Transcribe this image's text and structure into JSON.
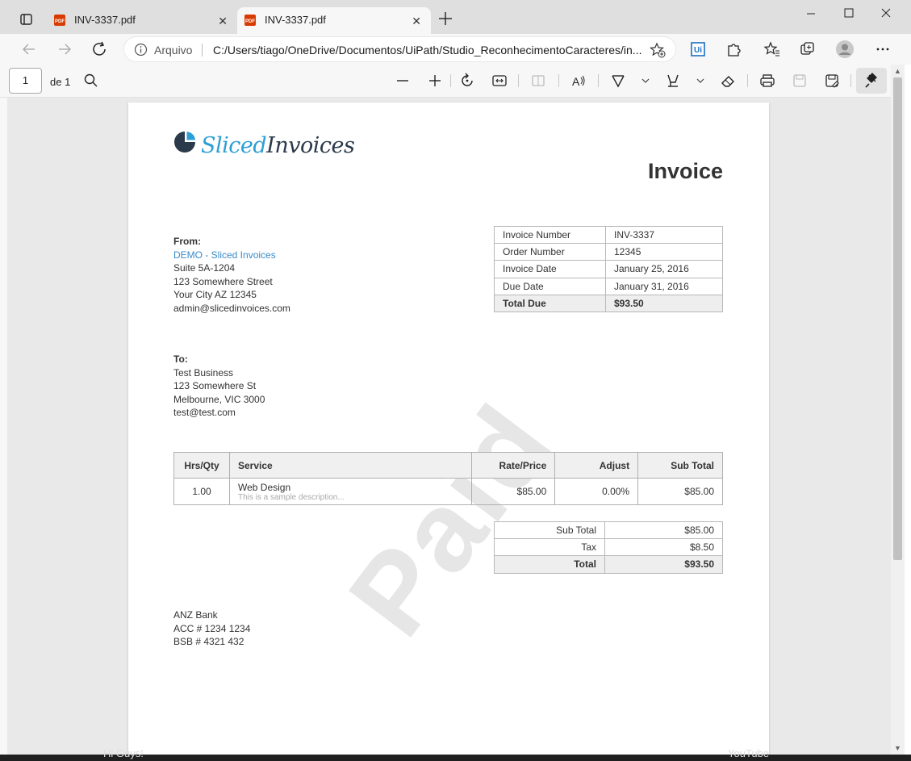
{
  "tabs": [
    {
      "label": "INV-3337.pdf",
      "active": false
    },
    {
      "label": "INV-3337.pdf",
      "active": true
    }
  ],
  "address_bar": {
    "scheme_label": "Arquivo",
    "url": "C:/Users/tiago/OneDrive/Documentos/UiPath/Studio_ReconhecimentoCaracteres/in..."
  },
  "pdf_toolbar": {
    "page_number": "1",
    "page_count": "de 1"
  },
  "invoice": {
    "logo": {
      "part1": "Sliced",
      "part2": "Invoices"
    },
    "title": "Invoice",
    "from": {
      "heading": "From:",
      "company": "DEMO - Sliced Invoices",
      "lines": [
        "Suite 5A-1204",
        "123 Somewhere Street",
        "Your City AZ 12345",
        "admin@slicedinvoices.com"
      ]
    },
    "to": {
      "heading": "To:",
      "lines": [
        "Test Business",
        "123 Somewhere St",
        "Melbourne, VIC 3000",
        "test@test.com"
      ]
    },
    "meta": [
      {
        "label": "Invoice Number",
        "value": "INV-3337"
      },
      {
        "label": "Order Number",
        "value": "12345"
      },
      {
        "label": "Invoice Date",
        "value": "January 25, 2016"
      },
      {
        "label": "Due Date",
        "value": "January 31, 2016"
      },
      {
        "label": "Total Due",
        "value": "$93.50"
      }
    ],
    "items_header": [
      "Hrs/Qty",
      "Service",
      "Rate/Price",
      "Adjust",
      "Sub Total"
    ],
    "items": [
      {
        "qty": "1.00",
        "service": "Web Design",
        "description": "This is a sample description...",
        "rate": "$85.00",
        "adjust": "0.00%",
        "subtotal": "$85.00"
      }
    ],
    "totals": [
      {
        "label": "Sub Total",
        "value": "$85.00"
      },
      {
        "label": "Tax",
        "value": "$8.50"
      },
      {
        "label": "Total",
        "value": "$93.50"
      }
    ],
    "bank": [
      "ANZ Bank",
      "ACC # 1234 1234",
      "BSB # 4321 432"
    ],
    "watermark": "Paid"
  },
  "background": {
    "left_caption": "Hi Guys!",
    "right_caption": "YouTube"
  },
  "colors": {
    "brand_blue": "#2e9fd4",
    "brand_dark": "#2b3a4a",
    "link": "#3a8bc7"
  }
}
